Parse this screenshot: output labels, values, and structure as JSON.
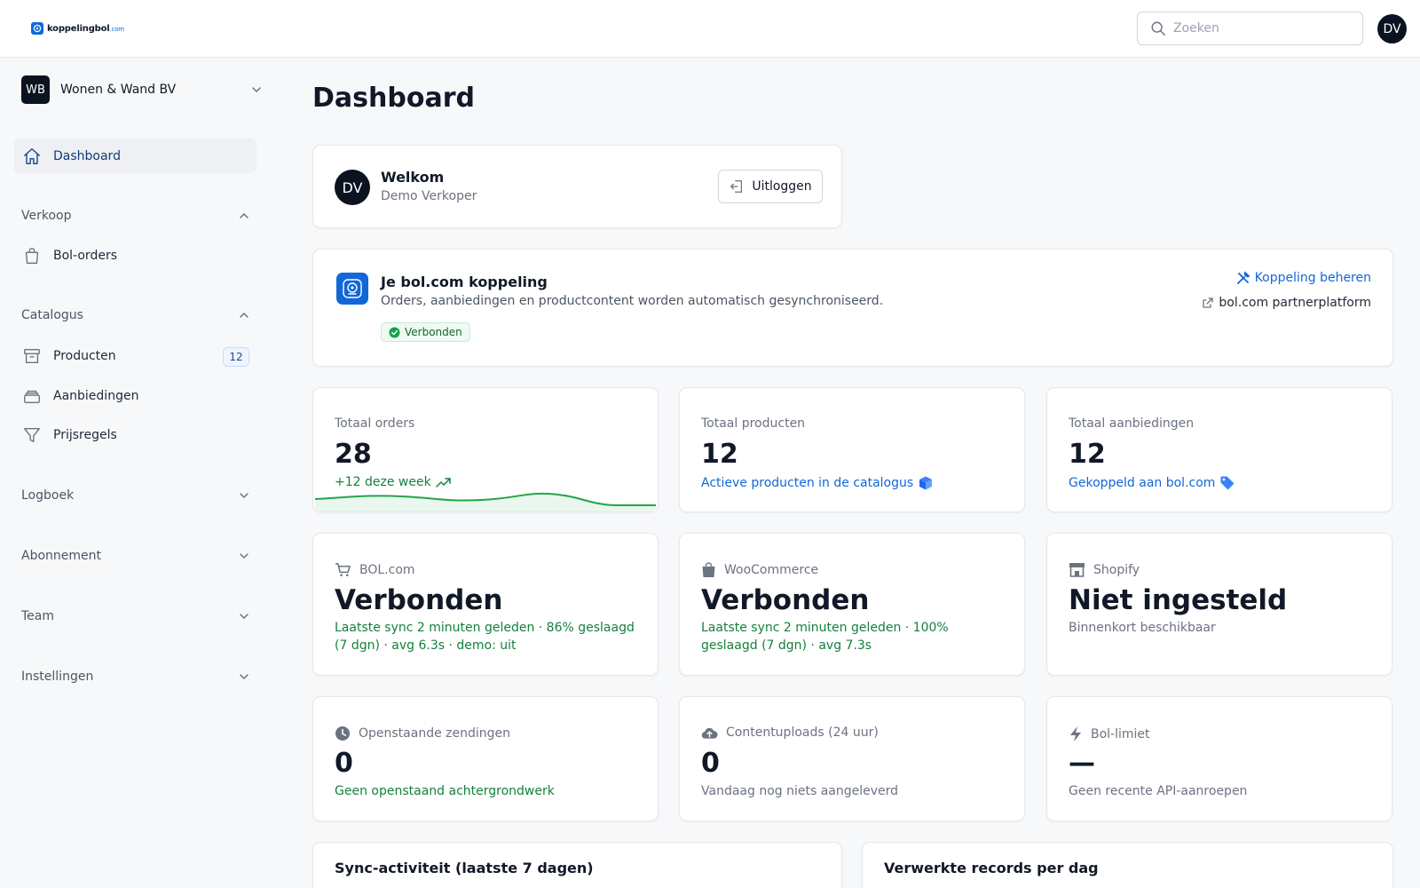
{
  "header": {
    "logo_text": "koppelingbol",
    "logo_suffix": ".com",
    "search_placeholder": "Zoeken",
    "search_value": "",
    "avatar_initials": "DV"
  },
  "sidebar": {
    "org": {
      "initials": "WB",
      "name": "Wonen & Wand BV"
    },
    "dashboard_label": "Dashboard",
    "sections": [
      {
        "label": "Verkoop",
        "expanded": true,
        "items": [
          {
            "label": "Bol-orders",
            "icon": "shopping-bag-icon"
          }
        ]
      },
      {
        "label": "Catalogus",
        "expanded": true,
        "items": [
          {
            "label": "Producten",
            "icon": "archive-box-icon",
            "badge": "12"
          },
          {
            "label": "Aanbiedingen",
            "icon": "stack-icon"
          },
          {
            "label": "Prijsregels",
            "icon": "funnel-icon"
          }
        ]
      },
      {
        "label": "Logboek",
        "expanded": false
      },
      {
        "label": "Abonnement",
        "expanded": false
      },
      {
        "label": "Team",
        "expanded": false
      },
      {
        "label": "Instellingen",
        "expanded": false
      }
    ]
  },
  "main": {
    "title": "Dashboard",
    "welcome": {
      "initials": "DV",
      "title": "Welkom",
      "subtitle": "Demo Verkoper",
      "logout_label": "Uitloggen"
    },
    "connection": {
      "title": "Je bol.com koppeling",
      "subtitle": "Orders, aanbiedingen en productcontent worden automatisch gesynchroniseerd.",
      "status": "Verbonden",
      "manage_label": "Koppeling beheren",
      "partner_label": "bol.com partnerplatform"
    },
    "stats": [
      {
        "label": "Totaal orders",
        "value": "28",
        "note": "+12 deze week"
      },
      {
        "label": "Totaal producten",
        "value": "12",
        "note": "Actieve producten in de catalogus"
      },
      {
        "label": "Totaal aanbiedingen",
        "value": "12",
        "note": "Gekoppeld aan bol.com"
      }
    ],
    "integrations": [
      {
        "label": "BOL.com",
        "value": "Verbonden",
        "note": "Laatste sync 2 minuten geleden · 86% geslaagd (7 dgn) · avg 6.3s · demo: uit"
      },
      {
        "label": "WooCommerce",
        "value": "Verbonden",
        "note": "Laatste sync 2 minuten geleden · 100% geslaagd (7 dgn) · avg 7.3s"
      },
      {
        "label": "Shopify",
        "value": "Niet ingesteld",
        "note": "Binnenkort beschikbaar"
      }
    ],
    "queues": [
      {
        "label": "Openstaande zendingen",
        "value": "0",
        "note": "Geen openstaand achtergrondwerk"
      },
      {
        "label": "Contentuploads (24 uur)",
        "value": "0",
        "note": "Vandaag nog niets aangeleverd"
      },
      {
        "label": "Bol-limiet",
        "value": "—",
        "note": "Geen recente API-aanroepen"
      }
    ],
    "charts": [
      {
        "title": "Sync-activiteit (laatste 7 dagen)"
      },
      {
        "title": "Verwerkte records per dag"
      }
    ]
  },
  "colors": {
    "accent": "#1167d8",
    "success": "#15803d",
    "dark": "#0b1220"
  }
}
